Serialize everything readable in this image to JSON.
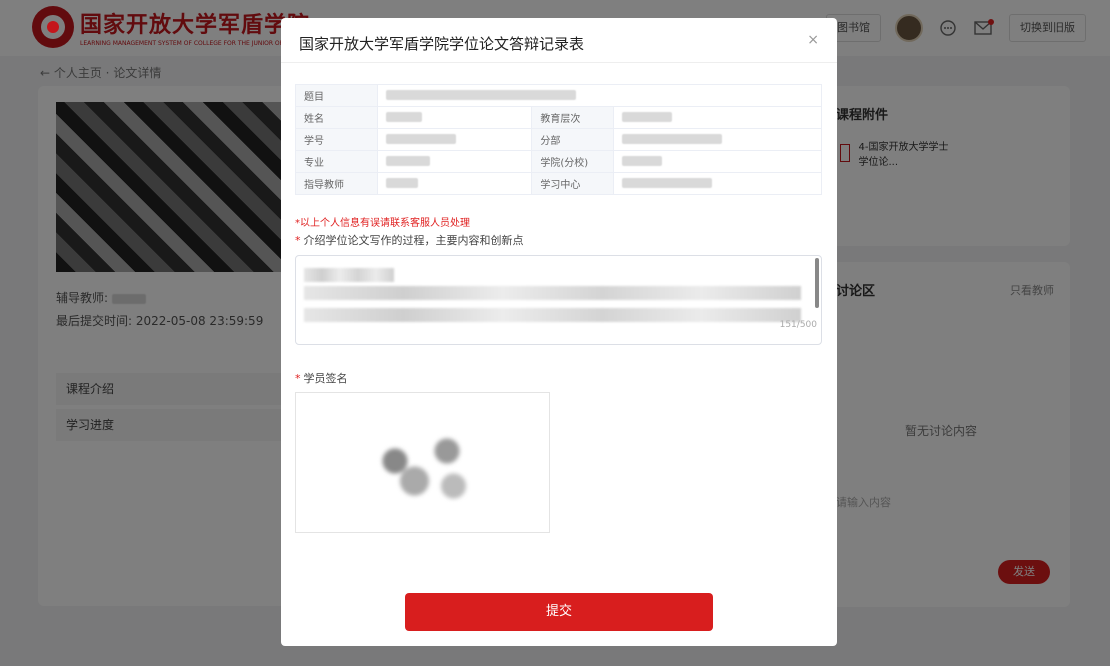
{
  "header": {
    "logo_title": "国家开放大学军盾学院",
    "logo_subtitle": "LEARNING MANAGEMENT SYSTEM OF COLLEGE FOR THE JUNIOR OF THE OPEN",
    "library_label": "图书馆",
    "switch_label": "切换到旧版"
  },
  "breadcrumb": "← 个人主页 · 论文详情",
  "left_panel": {
    "tutor_label": "辅导教师:",
    "submit_time_label": "最后提交时间:",
    "submit_time_value": "2022-05-08 23:59:59",
    "nav": [
      "课程介绍",
      "学习进度"
    ]
  },
  "right_panel": {
    "attachments_title": "课程附件",
    "attachment_name": "4-国家开放大学学士学位论...",
    "discussion_title": "讨论区",
    "teacher_only": "只看教师",
    "empty_text": "暂无讨论内容",
    "input_placeholder": "请输入内容",
    "send_label": "发送"
  },
  "modal": {
    "title": "国家开放大学军盾学院学位论文答辩记录表",
    "close": "×",
    "fields": {
      "topic": "题目",
      "name": "姓名",
      "edu_level": "教育层次",
      "student_id": "学号",
      "branch": "分部",
      "major": "专业",
      "school": "学院(分校)",
      "advisor": "指导教师",
      "center": "学习中心"
    },
    "warning": "*以上个人信息有误请联系客服人员处理",
    "process_label": "介绍学位论文写作的过程，主要内容和创新点",
    "counter": "151/500",
    "signature_label": "学员签名",
    "submit_label": "提交"
  },
  "colors": {
    "brand": "#c4161c",
    "submit": "#d81e1e",
    "warning": "#e02020"
  }
}
